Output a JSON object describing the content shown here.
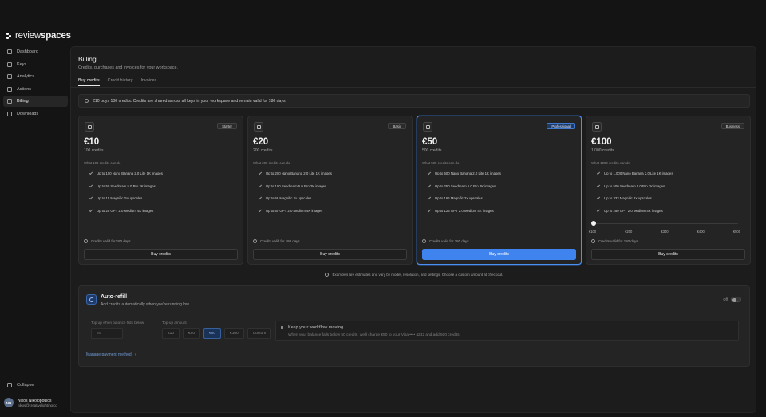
{
  "brand": {
    "prefix": "review",
    "suffix": "spaces"
  },
  "nav": {
    "items": [
      {
        "label": "Dashboard",
        "icon": "grid-icon"
      },
      {
        "label": "Keys",
        "icon": "key-icon"
      },
      {
        "label": "Analytics",
        "icon": "chart-icon"
      },
      {
        "label": "Actions",
        "icon": "sparkle-icon"
      },
      {
        "label": "Billing",
        "icon": "credit-card-icon",
        "active": true
      },
      {
        "label": "Downloads",
        "icon": "download-icon"
      }
    ],
    "collapse": "Collapse"
  },
  "user": {
    "initials": "NN",
    "name": "Nikos Nikolopoulos",
    "email": "nikos@creativelighting.co"
  },
  "page": {
    "title": "Billing",
    "subtitle": "Credits, purchases and invoices for your workspace.",
    "tabs": [
      "Buy credits",
      "Credit history",
      "Invoices"
    ],
    "info": "€10 buys 100 credits. Credits are shared across all keys in your workspace and remain valid for 180 days."
  },
  "plans": [
    {
      "badge": "Starter",
      "price": "€10",
      "credits": "100 credits",
      "whatcan": "What 100 credits can do",
      "features": [
        "Up to 100 Nano Banana 2.0 Lite 1K images",
        "Up to 50 Seedream 5.0 Pro 2K images",
        "Up to 15 Magnific 2x upscales",
        "Up to 25 GPT 2.0 Medium 4K images"
      ],
      "valid": "Credits valid for 180 days",
      "buy": "Buy credits"
    },
    {
      "badge": "Basic",
      "price": "€20",
      "credits": "200 credits",
      "whatcan": "What 200 credits can do",
      "features": [
        "Up to 200 Nano Banana 2.0 Lite 1K images",
        "Up to 100 Seedream 5.0 Pro 2K images",
        "Up to 66 Magnific 2x upscales",
        "Up to 50 GPT 2.0 Medium 4K images"
      ],
      "valid": "Credits valid for 180 days",
      "buy": "Buy credits"
    },
    {
      "badge": "Professional",
      "price": "€50",
      "credits": "500 credits",
      "whatcan": "What 500 credits can do",
      "features": [
        "Up to 500 Nano Banana 2.0 Lite 1K images",
        "Up to 250 Seedream 5.0 Pro 2K images",
        "Up to 166 Magnific 2x upscales",
        "Up to 125 GPT 2.0 Medium 4K images"
      ],
      "valid": "Credits valid for 180 days",
      "buy": "Buy credits"
    },
    {
      "badge": "Business",
      "price": "€100",
      "credits": "1,000 credits",
      "whatcan": "What 1000 credits can do",
      "features": [
        "Up to 1,000 Nano Banana 2.0 Lite 1K images",
        "Up to 500 Seedream 5.0 Pro 2K images",
        "Up to 333 Magnific 2x upscales",
        "Up to 250 GPT 2.0 Medium 4K images"
      ],
      "slider": {
        "value": 100,
        "ticks": [
          "€100",
          "€200",
          "€300",
          "€400",
          "€500"
        ]
      },
      "valid": "Credits valid for 180 days",
      "buy": "Buy credits"
    }
  ],
  "note": "Examples are estimates and vary by model, resolution, and settings. Choose a custom amount at checkout.",
  "autorefill": {
    "title": "Auto-refill",
    "subtitle": "Add credits automatically when you're running low.",
    "toggle_label": "Off",
    "threshold_label": "Top up when balance falls below",
    "threshold_value": "50",
    "amount_label": "Top-up amount",
    "amounts": [
      "€10",
      "€20",
      "€50",
      "€100",
      "Custom"
    ],
    "selected_amount": "€50",
    "keep_title": "Keep your workflow moving.",
    "keep_text": "When your balance falls below 50 credits, we'll charge €50 to your Visa •••• 4242 and add 500 credits.",
    "manage": "Manage payment method",
    "manage_arrow": "›"
  }
}
